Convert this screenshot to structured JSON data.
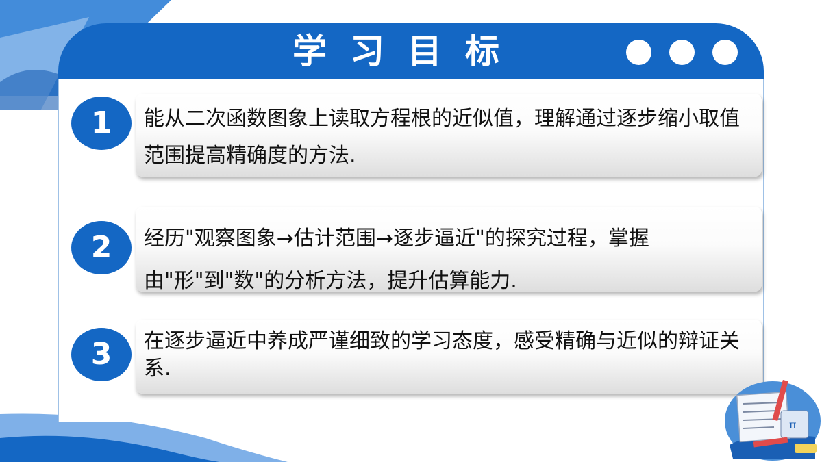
{
  "header": {
    "title": "学习目标"
  },
  "objectives": [
    {
      "number": "1",
      "text": "能从二次函数图象上读取方程根的近似值，理解通过逐步缩小取值范围提高精确度的方法."
    },
    {
      "number": "2",
      "text": "经历\"观察图象→估计范围→逐步逼近\"的探究过程，掌握由\"形\"到\"数\"的分析方法，提升估算能力."
    },
    {
      "number": "3",
      "text": "在逐步逼近中养成严谨细致的学习态度，感受精确与近似的辩证关系."
    }
  ],
  "colors": {
    "primary": "#1467c4",
    "accent_light": "#4a8fd8"
  },
  "decorations": {
    "corner_illustration": "math-study-illustration-icon"
  }
}
